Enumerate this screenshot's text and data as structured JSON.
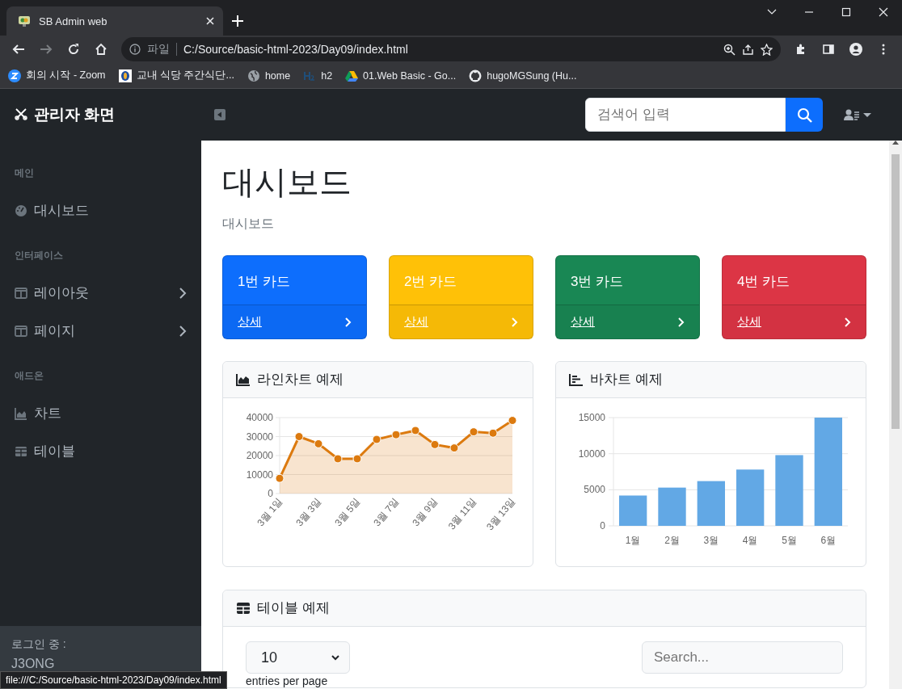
{
  "browser": {
    "tab": {
      "title": "SB Admin web",
      "selected": true
    },
    "address_prefix": "파일",
    "url": "C:/Source/basic-html-2023/Day09/index.html",
    "bookmarks": [
      {
        "label": "회의 시작 - Zoom",
        "kind": "zoom"
      },
      {
        "label": "교내 식당 주간식단...",
        "kind": "school"
      },
      {
        "label": "home",
        "kind": "globe"
      },
      {
        "label": "h2",
        "kind": "h2"
      },
      {
        "label": "01.Web Basic - Go...",
        "kind": "drive"
      },
      {
        "label": "hugoMGSung (Hu...",
        "kind": "github"
      }
    ]
  },
  "sidebar": {
    "brand": "관리자 화면",
    "sections": [
      {
        "heading": "메인",
        "items": [
          {
            "label": "대시보드",
            "kind": "dashboard",
            "expandable": false
          }
        ]
      },
      {
        "heading": "인터페이스",
        "items": [
          {
            "label": "레이아웃",
            "kind": "columns",
            "expandable": true
          },
          {
            "label": "페이지",
            "kind": "columns",
            "expandable": true
          }
        ]
      },
      {
        "heading": "애드온",
        "items": [
          {
            "label": "차트",
            "kind": "area",
            "expandable": false
          },
          {
            "label": "테이블",
            "kind": "table",
            "expandable": false
          }
        ]
      }
    ],
    "footer": {
      "label": "로그인 중 :",
      "user": "J3ONG"
    }
  },
  "topbar": {
    "search": {
      "placeholder": "검색어 입력"
    }
  },
  "page": {
    "title": "대시보드",
    "breadcrumb": "대시보드"
  },
  "cards": [
    {
      "title": "1번 카드",
      "link": "상세",
      "color": "#0d6efd"
    },
    {
      "title": "2번 카드",
      "link": "상세",
      "color": "#ffc107"
    },
    {
      "title": "3번 카드",
      "link": "상세",
      "color": "#198754"
    },
    {
      "title": "4번 카드",
      "link": "상세",
      "color": "#dc3545"
    }
  ],
  "line_card": {
    "title": "라인차트 예제",
    "chart_data": {
      "type": "area",
      "grid": true,
      "ylim": [
        0,
        40000
      ],
      "yticks": [
        0,
        10000,
        20000,
        30000,
        40000
      ],
      "categories": [
        "3월 1일",
        null,
        "3월 3일",
        null,
        "3월 5일",
        null,
        "3월 7일",
        null,
        "3월 9일",
        null,
        "3월 11일",
        null,
        "3월 13일"
      ],
      "series": [
        {
          "color": "#dc7a0f",
          "values": [
            8000,
            30000,
            26200,
            18300,
            18300,
            28500,
            31000,
            33200,
            25800,
            24000,
            32500,
            31800,
            38500
          ]
        }
      ]
    }
  },
  "bar_card": {
    "title": "바차트 예제",
    "chart_data": {
      "type": "bar",
      "grid": true,
      "categories": [
        "1월",
        "2월",
        "3월",
        "4월",
        "5월",
        "6월"
      ],
      "ylim": [
        0,
        15000
      ],
      "yticks": [
        0,
        5000,
        10000,
        15000
      ],
      "series": [
        {
          "color": "#62a8e5",
          "values": [
            4200,
            5300,
            6200,
            7800,
            9800,
            15000
          ]
        }
      ]
    }
  },
  "table_card": {
    "title": "테이블 예제",
    "page_size": "10",
    "page_size_caption": "entries per page",
    "search": {
      "placeholder": "Search..."
    }
  },
  "status_url": "file:///C:/Source/basic-html-2023/Day09/index.html"
}
